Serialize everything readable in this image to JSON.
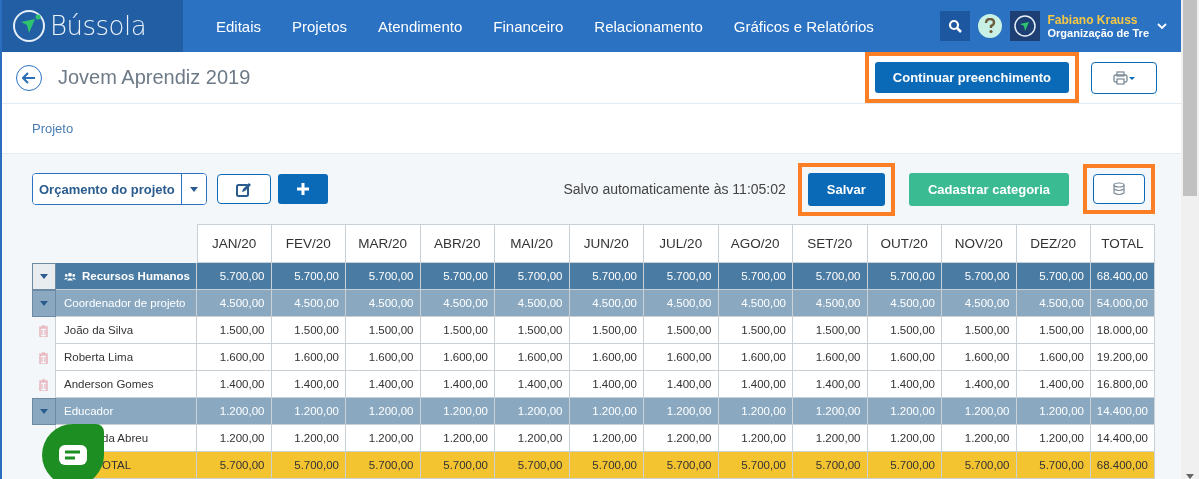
{
  "app": {
    "name": "Bússola"
  },
  "nav": [
    "Editais",
    "Projetos",
    "Atendimento",
    "Financeiro",
    "Relacionamento",
    "Gráficos e Relatórios"
  ],
  "user": {
    "name": "Fabiano Krauss",
    "org": "Organização de Tre"
  },
  "page": {
    "title": "Jovem Aprendiz 2019",
    "primary_button": {
      "label": "Continuar preenchimento",
      "highlighted": true
    },
    "print_highlighted": false
  },
  "tabs": [
    {
      "label": "Projeto",
      "selected": false
    }
  ],
  "toolbar": {
    "dropdown": "Orçamento do projeto",
    "saved_text": "Salvo automaticamente às 11:05:02",
    "save_button": {
      "label": "Salvar",
      "highlighted": true
    },
    "category_button": {
      "label": "Cadastrar categoria",
      "highlighted": false
    },
    "db_highlighted": true
  },
  "table": {
    "columns": [
      "JAN/20",
      "FEV/20",
      "MAR/20",
      "ABR/20",
      "MAI/20",
      "JUN/20",
      "JUL/20",
      "AGO/20",
      "SET/20",
      "OUT/20",
      "NOV/20",
      "DEZ/20",
      "TOTAL"
    ],
    "rows": [
      {
        "kind": "group",
        "label": "Recursos Humanos",
        "values": [
          "5.700,00",
          "5.700,00",
          "5.700,00",
          "5.700,00",
          "5.700,00",
          "5.700,00",
          "5.700,00",
          "5.700,00",
          "5.700,00",
          "5.700,00",
          "5.700,00",
          "5.700,00",
          "68.400,00"
        ]
      },
      {
        "kind": "subgroup",
        "label": "Coordenador de projeto",
        "values": [
          "4.500,00",
          "4.500,00",
          "4.500,00",
          "4.500,00",
          "4.500,00",
          "4.500,00",
          "4.500,00",
          "4.500,00",
          "4.500,00",
          "4.500,00",
          "4.500,00",
          "4.500,00",
          "54.000,00"
        ]
      },
      {
        "kind": "item",
        "label": "João da Silva",
        "values": [
          "1.500,00",
          "1.500,00",
          "1.500,00",
          "1.500,00",
          "1.500,00",
          "1.500,00",
          "1.500,00",
          "1.500,00",
          "1.500,00",
          "1.500,00",
          "1.500,00",
          "1.500,00",
          "18.000,00"
        ]
      },
      {
        "kind": "item",
        "label": "Roberta Lima",
        "values": [
          "1.600,00",
          "1.600,00",
          "1.600,00",
          "1.600,00",
          "1.600,00",
          "1.600,00",
          "1.600,00",
          "1.600,00",
          "1.600,00",
          "1.600,00",
          "1.600,00",
          "1.600,00",
          "19.200,00"
        ]
      },
      {
        "kind": "item",
        "label": "Anderson Gomes",
        "values": [
          "1.400,00",
          "1.400,00",
          "1.400,00",
          "1.400,00",
          "1.400,00",
          "1.400,00",
          "1.400,00",
          "1.400,00",
          "1.400,00",
          "1.400,00",
          "1.400,00",
          "1.400,00",
          "16.800,00"
        ]
      },
      {
        "kind": "subgroup",
        "label": "Educador",
        "values": [
          "1.200,00",
          "1.200,00",
          "1.200,00",
          "1.200,00",
          "1.200,00",
          "1.200,00",
          "1.200,00",
          "1.200,00",
          "1.200,00",
          "1.200,00",
          "1.200,00",
          "1.200,00",
          "14.400,00"
        ]
      },
      {
        "kind": "item",
        "label": "da Abreu",
        "values": [
          "1.200,00",
          "1.200,00",
          "1.200,00",
          "1.200,00",
          "1.200,00",
          "1.200,00",
          "1.200,00",
          "1.200,00",
          "1.200,00",
          "1.200,00",
          "1.200,00",
          "1.200,00",
          "14.400,00"
        ]
      },
      {
        "kind": "total",
        "label": "OTAL",
        "values": [
          "5.700,00",
          "5.700,00",
          "5.700,00",
          "5.700,00",
          "5.700,00",
          "5.700,00",
          "5.700,00",
          "5.700,00",
          "5.700,00",
          "5.700,00",
          "5.700,00",
          "5.700,00",
          "68.400,00"
        ]
      }
    ]
  }
}
